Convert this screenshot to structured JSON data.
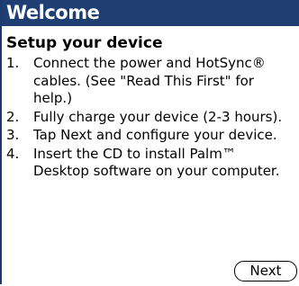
{
  "titlebar": {
    "title": "Welcome"
  },
  "content": {
    "heading": "Setup your device",
    "steps": [
      {
        "number": "1.",
        "text": "Connect the power and HotSync® cables. (See \"Read This First\" for help.)"
      },
      {
        "number": "2.",
        "text": "Fully charge your device (2-3 hours)."
      },
      {
        "number": "3.",
        "text": "Tap Next and configure your device."
      },
      {
        "number": "4.",
        "text": "Insert the CD to install Palm™ Desktop software on your computer."
      }
    ]
  },
  "buttons": {
    "next_label": "Next"
  },
  "colors": {
    "titlebar_background": "#1f3f73",
    "titlebar_text": "#ffffff",
    "background": "#ffffff",
    "text": "#000000"
  }
}
